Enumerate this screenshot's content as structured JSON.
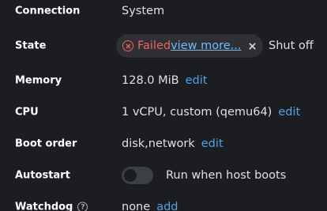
{
  "rows": {
    "connection": {
      "label": "Connection",
      "value": "System"
    },
    "state": {
      "label": "State",
      "status": "Failed",
      "view_more": "view more...",
      "power_state": "Shut off",
      "error_color": "#f0645c",
      "error_icon": "error-circle-icon",
      "close_icon": "close-icon"
    },
    "memory": {
      "label": "Memory",
      "value": "128.0 MiB",
      "action": "edit"
    },
    "cpu": {
      "label": "CPU",
      "value": "1 vCPU, custom (qemu64)",
      "action": "edit"
    },
    "boot_order": {
      "label": "Boot order",
      "value": "disk,network",
      "action": "edit"
    },
    "autostart": {
      "label": "Autostart",
      "toggle_on": false,
      "toggle_label": "Run when host boots"
    },
    "watchdog": {
      "label": "Watchdog",
      "value": "none",
      "action": "add",
      "help_icon": "help-icon"
    }
  },
  "colors": {
    "background": "#1b1d21",
    "link": "#4fa3e8",
    "chip_background": "#2e3036"
  }
}
